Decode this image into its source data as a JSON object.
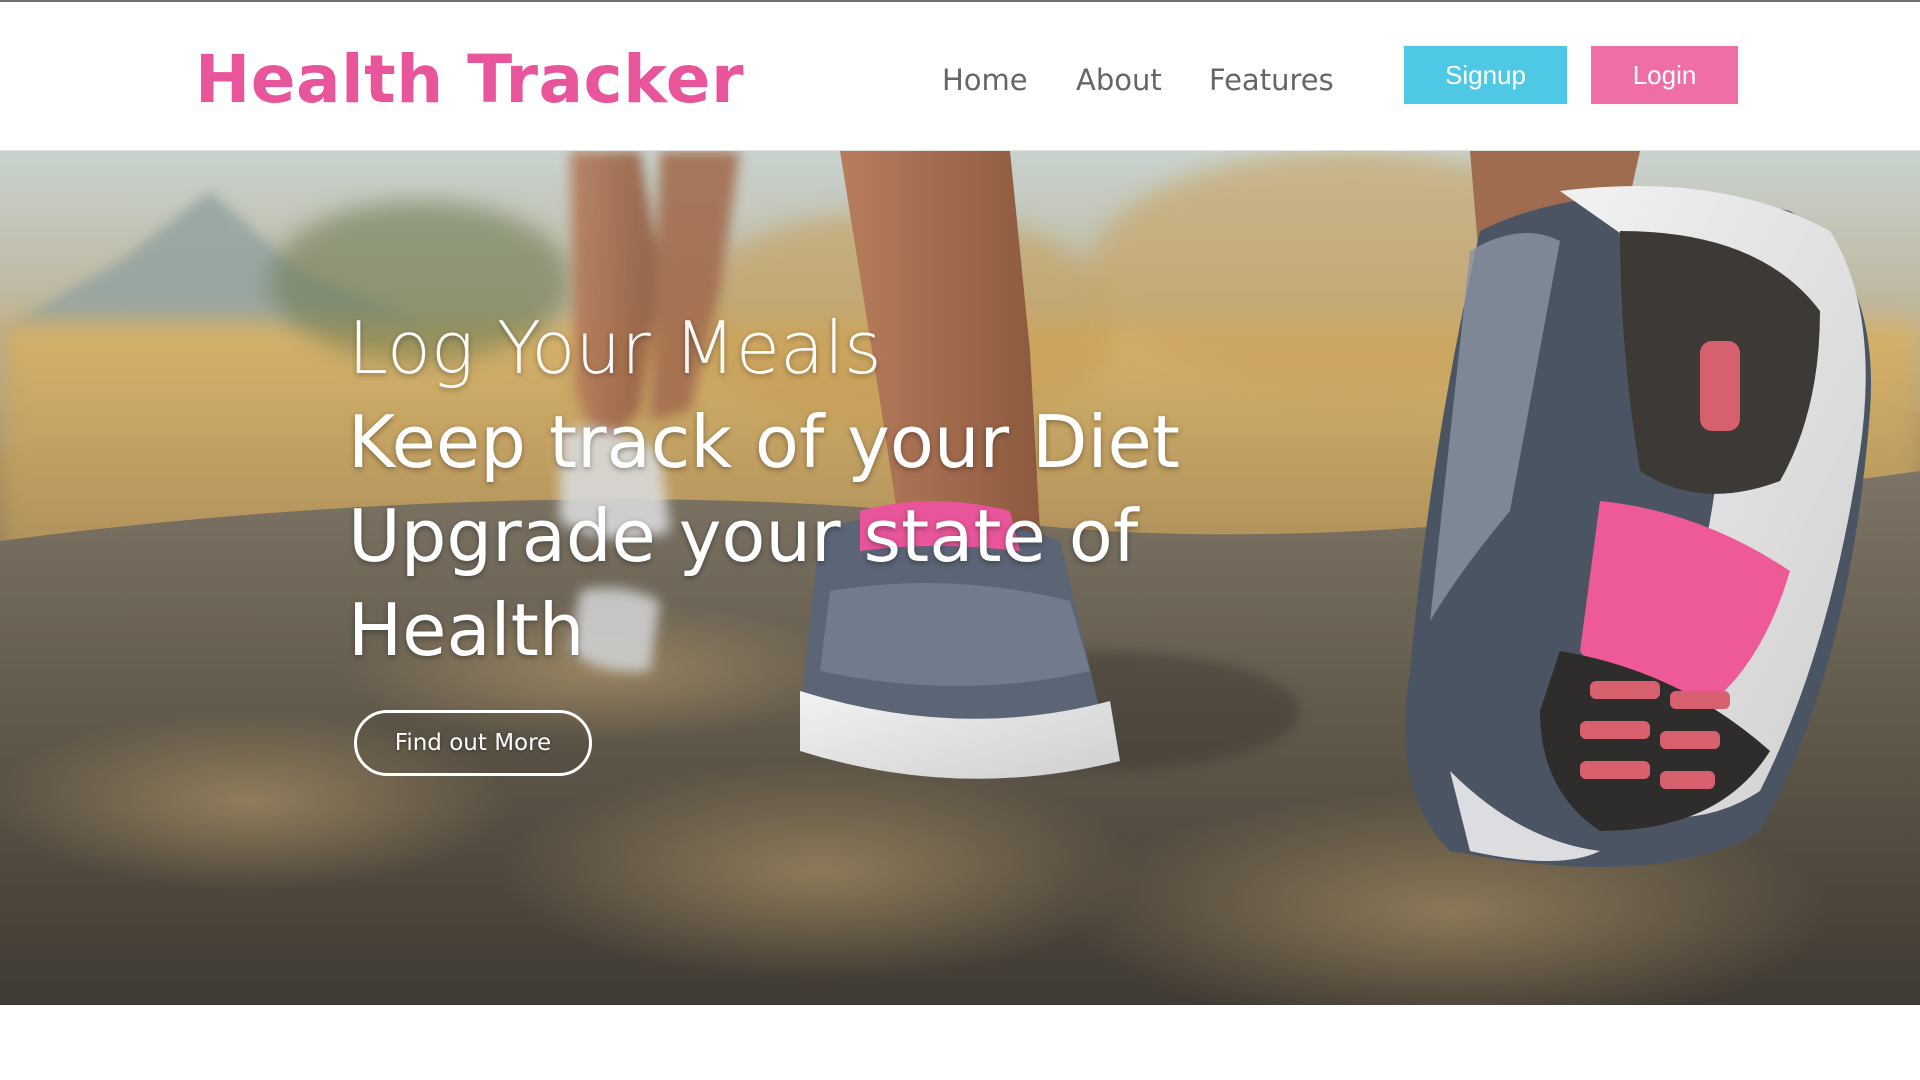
{
  "header": {
    "brand": "Health Tracker",
    "nav": [
      {
        "label": "Home"
      },
      {
        "label": "About"
      },
      {
        "label": "Features"
      }
    ],
    "signup_label": "Signup",
    "login_label": "Login"
  },
  "hero": {
    "lines": [
      "Log Your Meals",
      "Keep track of your Diet",
      "Upgrade your state of",
      "Health"
    ],
    "cta_label": "Find out More"
  },
  "colors": {
    "brand": "#e8559a",
    "signup_bg": "#4fc8e6",
    "login_bg": "#ef6ea8",
    "nav_text": "#666666"
  },
  "icons": {
    "hero_image": "running-shoes-photo"
  }
}
